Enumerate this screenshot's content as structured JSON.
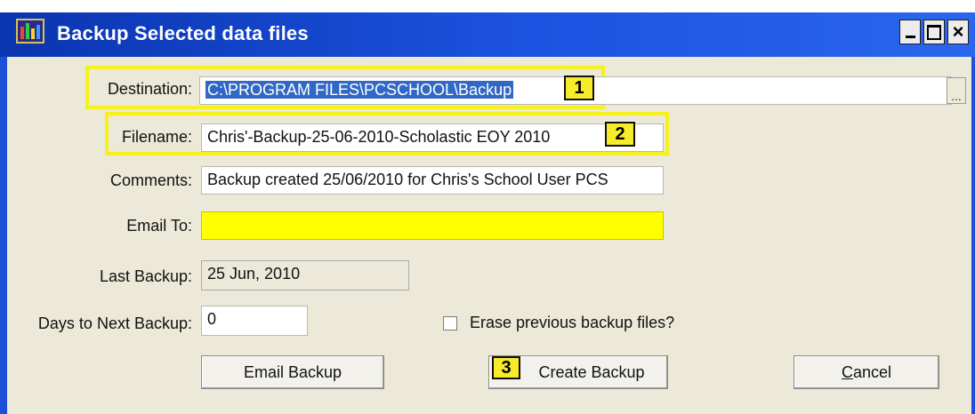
{
  "window": {
    "title": "Backup Selected data files",
    "controls": {
      "minimize": "-",
      "maximize": "□",
      "close": "×"
    }
  },
  "form": {
    "destination": {
      "label": "Destination:",
      "value": "C:\\PROGRAM FILES\\PCSCHOOL\\Backup",
      "browse": "..."
    },
    "filename": {
      "label": "Filename:",
      "value": "Chris'-Backup-25-06-2010-Scholastic EOY 2010"
    },
    "comments": {
      "label": "Comments:",
      "value": "Backup  created 25/06/2010 for Chris's School User PCS"
    },
    "email_to": {
      "label": "Email To:",
      "value": ""
    },
    "last_backup": {
      "label": "Last Backup:",
      "value": "25 Jun, 2010"
    },
    "days_to_next": {
      "label": "Days to Next Backup:",
      "value": "0"
    },
    "erase_previous": {
      "label": "Erase previous backup files?",
      "checked": false
    }
  },
  "buttons": {
    "email": "Email Backup",
    "create": "Create Backup",
    "cancel_first": "C",
    "cancel_rest": "ancel"
  },
  "callouts": {
    "one": "1",
    "two": "2",
    "three": "3"
  },
  "colors": {
    "titlebar": "#1c53e0",
    "highlight": "#f5f01e",
    "email_field": "#ffff00"
  }
}
